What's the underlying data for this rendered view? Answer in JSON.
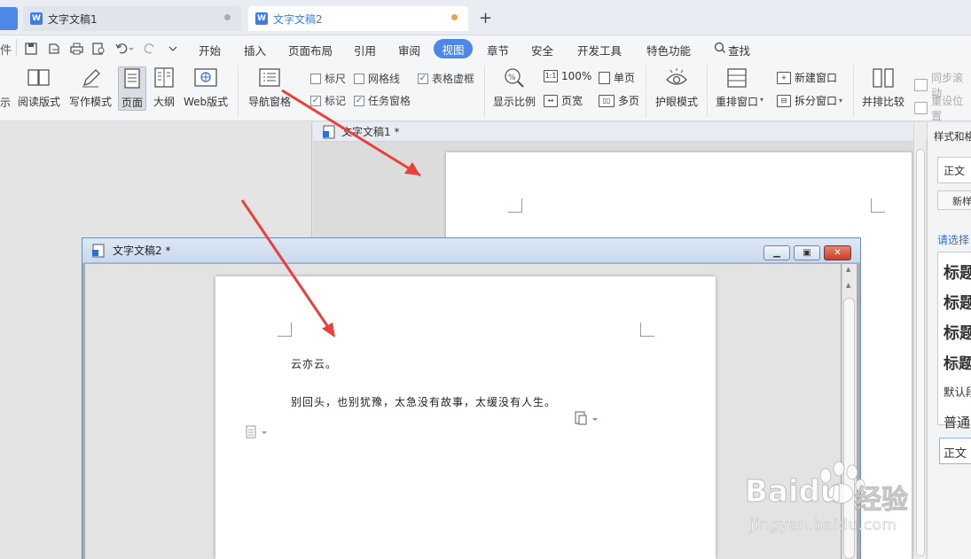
{
  "tabs": [
    {
      "title": "文字文稿1",
      "active": false
    },
    {
      "title": "文字文稿2",
      "active": true
    }
  ],
  "menu": {
    "left_partial": "件",
    "items": [
      "开始",
      "插入",
      "页面布局",
      "引用",
      "审阅",
      "视图",
      "章节",
      "安全",
      "开发工具",
      "特色功能"
    ],
    "active": "视图",
    "search": "查找"
  },
  "ribbon": {
    "partial_left": "示",
    "reading_mode": "阅读版式",
    "writing_mode": "写作模式",
    "page": "页面",
    "outline": "大纲",
    "web": "Web版式",
    "nav_pane": "导航窗格",
    "ruler": "标尺",
    "gridlines": "网格线",
    "table_dashed": "表格虚框",
    "markup": "标记",
    "task_pane": "任务窗格",
    "zoom": "显示比例",
    "zoom_100": "100%",
    "page_width": "页宽",
    "single_page": "单页",
    "multi_page": "多页",
    "eye_mode": "护眼模式",
    "arrange_windows": "重排窗口",
    "new_window": "新建窗口",
    "split_window": "拆分窗口",
    "side_by_side": "并排比较",
    "sync_scroll": "同步滚动",
    "reset_position": "重设位置",
    "checks": {
      "ruler": false,
      "gridlines": false,
      "table_dashed": true,
      "markup": true,
      "task_pane": true
    }
  },
  "doc1": {
    "title": "文字文稿1 *"
  },
  "doc2": {
    "title": "文字文稿2 *",
    "lines": [
      "云亦云。",
      "别回头，也别犹豫，太急没有故事，太缓没有人生。"
    ]
  },
  "side_panel": {
    "title": "样式和格",
    "style_value": "正文",
    "new_style": "新样",
    "choose": "请选择",
    "styles": [
      "标题",
      "标题",
      "标题",
      "标题"
    ],
    "default": "默认段",
    "normal": "普通",
    "normal_value": "正文"
  },
  "watermark": {
    "brand": "Baidu",
    "brand_cn": "经验",
    "url": "jingyan.baidu.com"
  },
  "colors": {
    "accent": "#4d88e8",
    "arrow": "#e8403a"
  }
}
